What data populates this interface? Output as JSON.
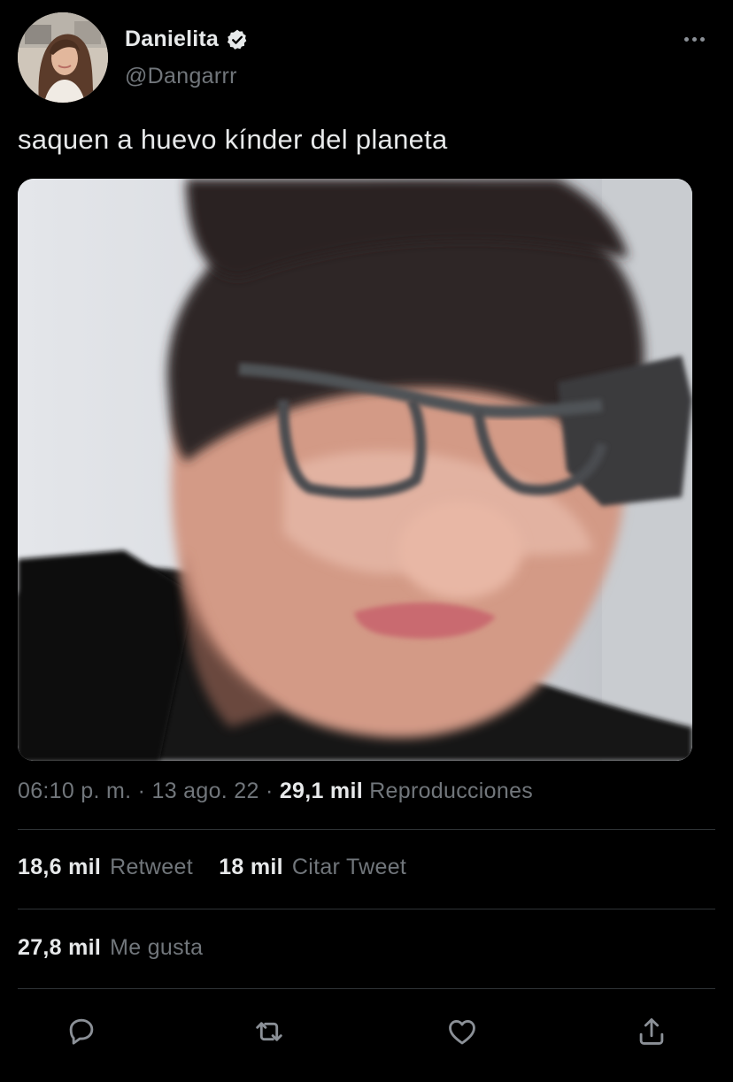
{
  "tweet": {
    "author": {
      "display_name": "Danielita",
      "handle": "@Dangarrr",
      "verified": true,
      "verified_icon": "verified-badge-icon"
    },
    "more_icon": "more-dots-icon",
    "text": "saquen a huevo kínder del planeta",
    "media": {
      "type": "image"
    },
    "meta": {
      "time": "06:10 p. m.",
      "separator": "·",
      "date": "13 ago. 22",
      "views_count": "29,1 mil",
      "views_label": "Reproducciones"
    },
    "stats": {
      "retweets_count": "18,6 mil",
      "retweets_label": "Retweet",
      "quotes_count": "18 mil",
      "quotes_label": "Citar Tweet",
      "likes_count": "27,8 mil",
      "likes_label": "Me gusta"
    },
    "actions": [
      {
        "icon": "reply-icon"
      },
      {
        "icon": "retweet-icon"
      },
      {
        "icon": "like-heart-icon"
      },
      {
        "icon": "share-icon"
      }
    ]
  },
  "colors": {
    "background": "#000000",
    "primary_text": "#e7e9ea",
    "secondary_text": "#71767b",
    "divider": "#2f3336",
    "verified_badge": "#e7e9ea"
  }
}
